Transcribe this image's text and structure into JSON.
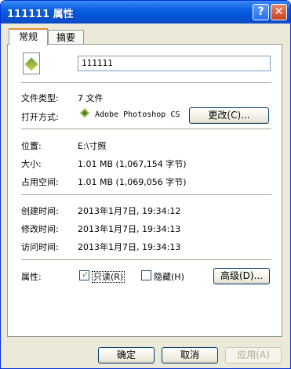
{
  "window": {
    "title": "111111 属性",
    "help": "?",
    "close": "✕"
  },
  "tabs": [
    {
      "label": "常规"
    },
    {
      "label": "摘要"
    }
  ],
  "file": {
    "name": "111111"
  },
  "info": {
    "type_label": "文件类型:",
    "type_value": "7 文件",
    "open_label": "打开方式:",
    "open_value": "Adobe Photoshop CS",
    "change_button": "更改(C)...",
    "location_label": "位置:",
    "location_value": "E:\\寸照",
    "size_label": "大小:",
    "size_value": "1.01 MB (1,067,154 字节)",
    "disk_label": "占用空间:",
    "disk_value": "1.01 MB (1,069,056 字节)",
    "created_label": "创建时间:",
    "created_value": "2013年1月7日, 19:34:12",
    "modified_label": "修改时间:",
    "modified_value": "2013年1月7日, 19:34:13",
    "accessed_label": "访问时间:",
    "accessed_value": "2013年1月7日, 19:34:13"
  },
  "attributes": {
    "label": "属性:",
    "readonly": {
      "label": "只读(R)",
      "checked": true
    },
    "hidden": {
      "label": "隐藏(H)",
      "checked": false
    },
    "advanced_button": "高级(D)..."
  },
  "buttons": {
    "ok": "确定",
    "cancel": "取消",
    "apply": "应用(A)"
  }
}
